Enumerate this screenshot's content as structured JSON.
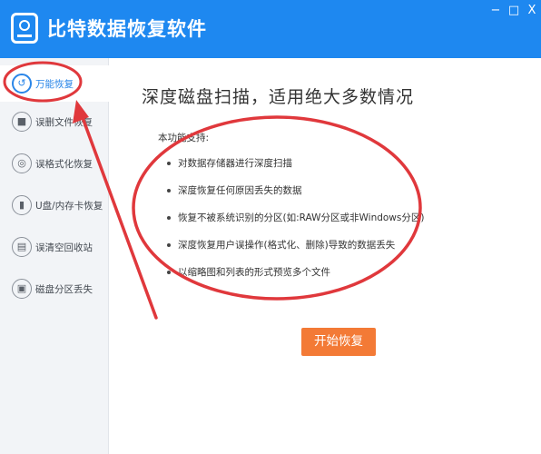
{
  "app": {
    "title": "比特数据恢复软件"
  },
  "window_controls": {
    "minimize": "−",
    "maximize": "□",
    "close": "X"
  },
  "sidebar": {
    "items": [
      {
        "label": "万能恢复",
        "icon": "refresh-icon",
        "active": true
      },
      {
        "label": "误删文件恢复",
        "icon": "folder-icon",
        "active": false
      },
      {
        "label": "误格式化恢复",
        "icon": "disk-icon",
        "active": false
      },
      {
        "label": "U盘/内存卡恢复",
        "icon": "usb-icon",
        "active": false
      },
      {
        "label": "误清空回收站",
        "icon": "trash-icon",
        "active": false
      },
      {
        "label": "磁盘分区丢失",
        "icon": "save-icon",
        "active": false
      }
    ]
  },
  "main": {
    "title": "深度磁盘扫描，适用绝大多数情况",
    "intro": "本功能支持:",
    "features": [
      "对数据存储器进行深度扫描",
      "深度恢复任何原因丢失的数据",
      "恢复不被系统识别的分区(如:RAW分区或非Windows分区)",
      "深度恢复用户误操作(格式化、删除)导致的数据丢失",
      "以缩略图和列表的形式预览多个文件"
    ],
    "start_button": "开始恢复"
  },
  "colors": {
    "titlebar": "#1e88f0",
    "accent": "#2a86e8",
    "start_button": "#f37a36",
    "annotation": "#e0383c"
  }
}
